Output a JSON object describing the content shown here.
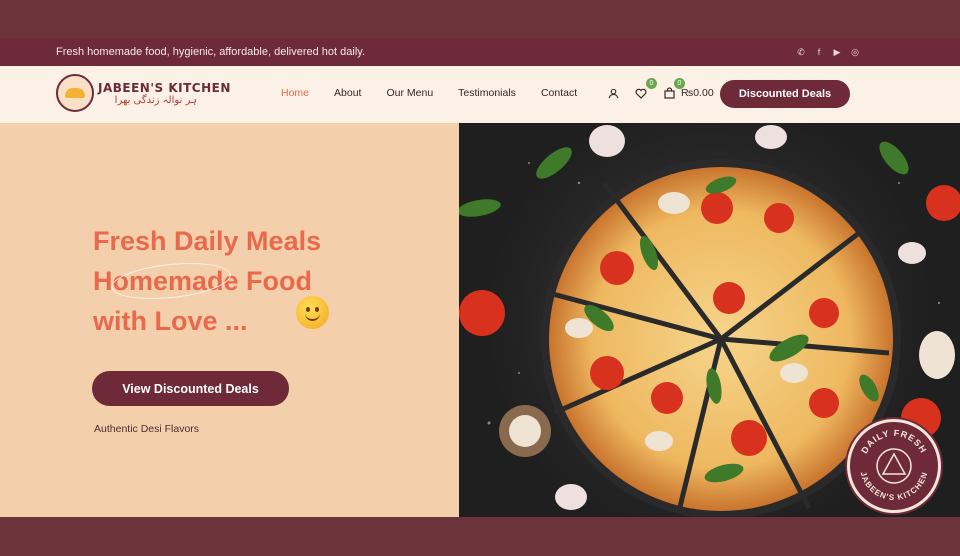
{
  "topbar": {
    "tagline": "Fresh homemade food, hygienic, affordable, delivered hot daily.",
    "socials": [
      "whatsapp-icon",
      "facebook-icon",
      "youtube-icon",
      "instagram-icon"
    ]
  },
  "brand": {
    "name": "JABEEN'S KITCHEN",
    "tagline_urdu": "ہر نوالہ زندگی بھرا"
  },
  "nav": {
    "items": [
      {
        "label": "Home",
        "active": true
      },
      {
        "label": "About"
      },
      {
        "label": "Our Menu"
      },
      {
        "label": "Testimonials"
      },
      {
        "label": "Contact"
      }
    ]
  },
  "header_actions": {
    "wishlist_count": "0",
    "cart_count": "0",
    "cart_total": "₨0.00",
    "deals_label": "Discounted Deals"
  },
  "hero": {
    "title_line1": "Fresh Daily Meals",
    "title_line2": "Homemade Food",
    "title_line3": "with Love ...",
    "cta_label": "View Discounted Deals",
    "note": "Authentic Desi Flavors"
  },
  "badge": {
    "top_text": "DAILY FRESH",
    "bottom_text": "JABEEN'S KITCHEN"
  },
  "colors": {
    "brand": "#6e2a38",
    "accent": "#e86a4c",
    "hero_bg": "#f4cfac",
    "nav_bg": "#fbf1e6"
  }
}
